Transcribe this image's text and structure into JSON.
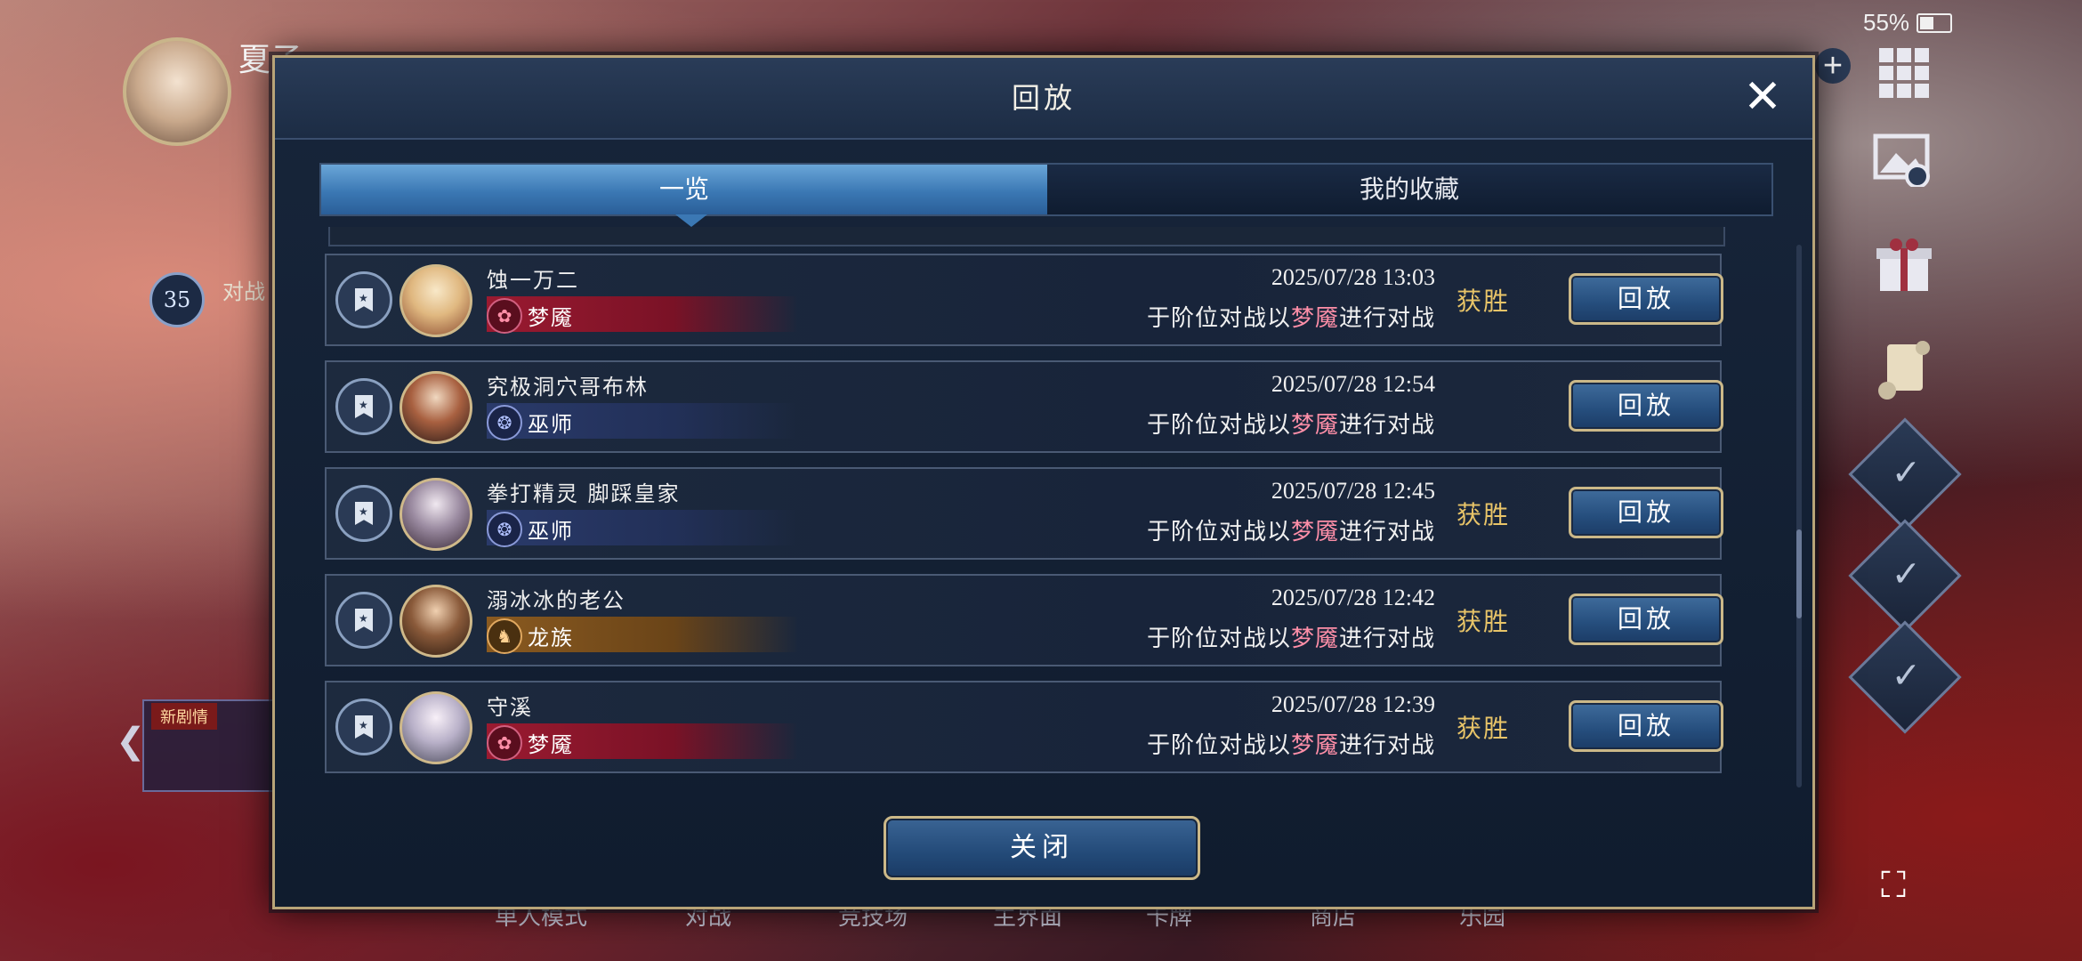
{
  "status_bar": {
    "battery": "55%"
  },
  "background": {
    "player_name": "夏子",
    "level": "35",
    "battle_label": "对战",
    "story_badge": "新剧情",
    "bottom_nav": [
      "单人模式",
      "对战",
      "竞技场",
      "主界面",
      "卡牌",
      "商店",
      "乐园"
    ]
  },
  "modal": {
    "title": "回放",
    "close_icon": "close-icon",
    "tabs": [
      {
        "label": "一览",
        "active": true
      },
      {
        "label": "我的收藏",
        "active": false
      }
    ],
    "rows": [
      {
        "player": "蚀一万二",
        "class": "梦魇",
        "class_color": "#9a1a30",
        "date": "2025/07/28  13:03",
        "desc_prefix": "于阶位对战以",
        "desc_class": "梦魇",
        "desc_suffix": "进行对战",
        "result": "获胜",
        "replay_label": "回放"
      },
      {
        "player": "究极洞穴哥布林",
        "class": "巫师",
        "class_color": "#2a3a6a",
        "date": "2025/07/28  12:54",
        "desc_prefix": "于阶位对战以",
        "desc_class": "梦魇",
        "desc_suffix": "进行对战",
        "result": "",
        "replay_label": "回放"
      },
      {
        "player": "拳打精灵 脚踩皇家",
        "class": "巫师",
        "class_color": "#2a3a6a",
        "date": "2025/07/28  12:45",
        "desc_prefix": "于阶位对战以",
        "desc_class": "梦魇",
        "desc_suffix": "进行对战",
        "result": "获胜",
        "replay_label": "回放"
      },
      {
        "player": "溺冰冰的老公",
        "class": "龙族",
        "class_color": "#8a5a20",
        "date": "2025/07/28  12:42",
        "desc_prefix": "于阶位对战以",
        "desc_class": "梦魇",
        "desc_suffix": "进行对战",
        "result": "获胜",
        "replay_label": "回放"
      },
      {
        "player": "守溪",
        "class": "梦魇",
        "class_color": "#9a1a30",
        "date": "2025/07/28  12:39",
        "desc_prefix": "于阶位对战以",
        "desc_class": "梦魇",
        "desc_suffix": "进行对战",
        "result": "获胜",
        "replay_label": "回放"
      }
    ],
    "close_button": "关闭"
  }
}
